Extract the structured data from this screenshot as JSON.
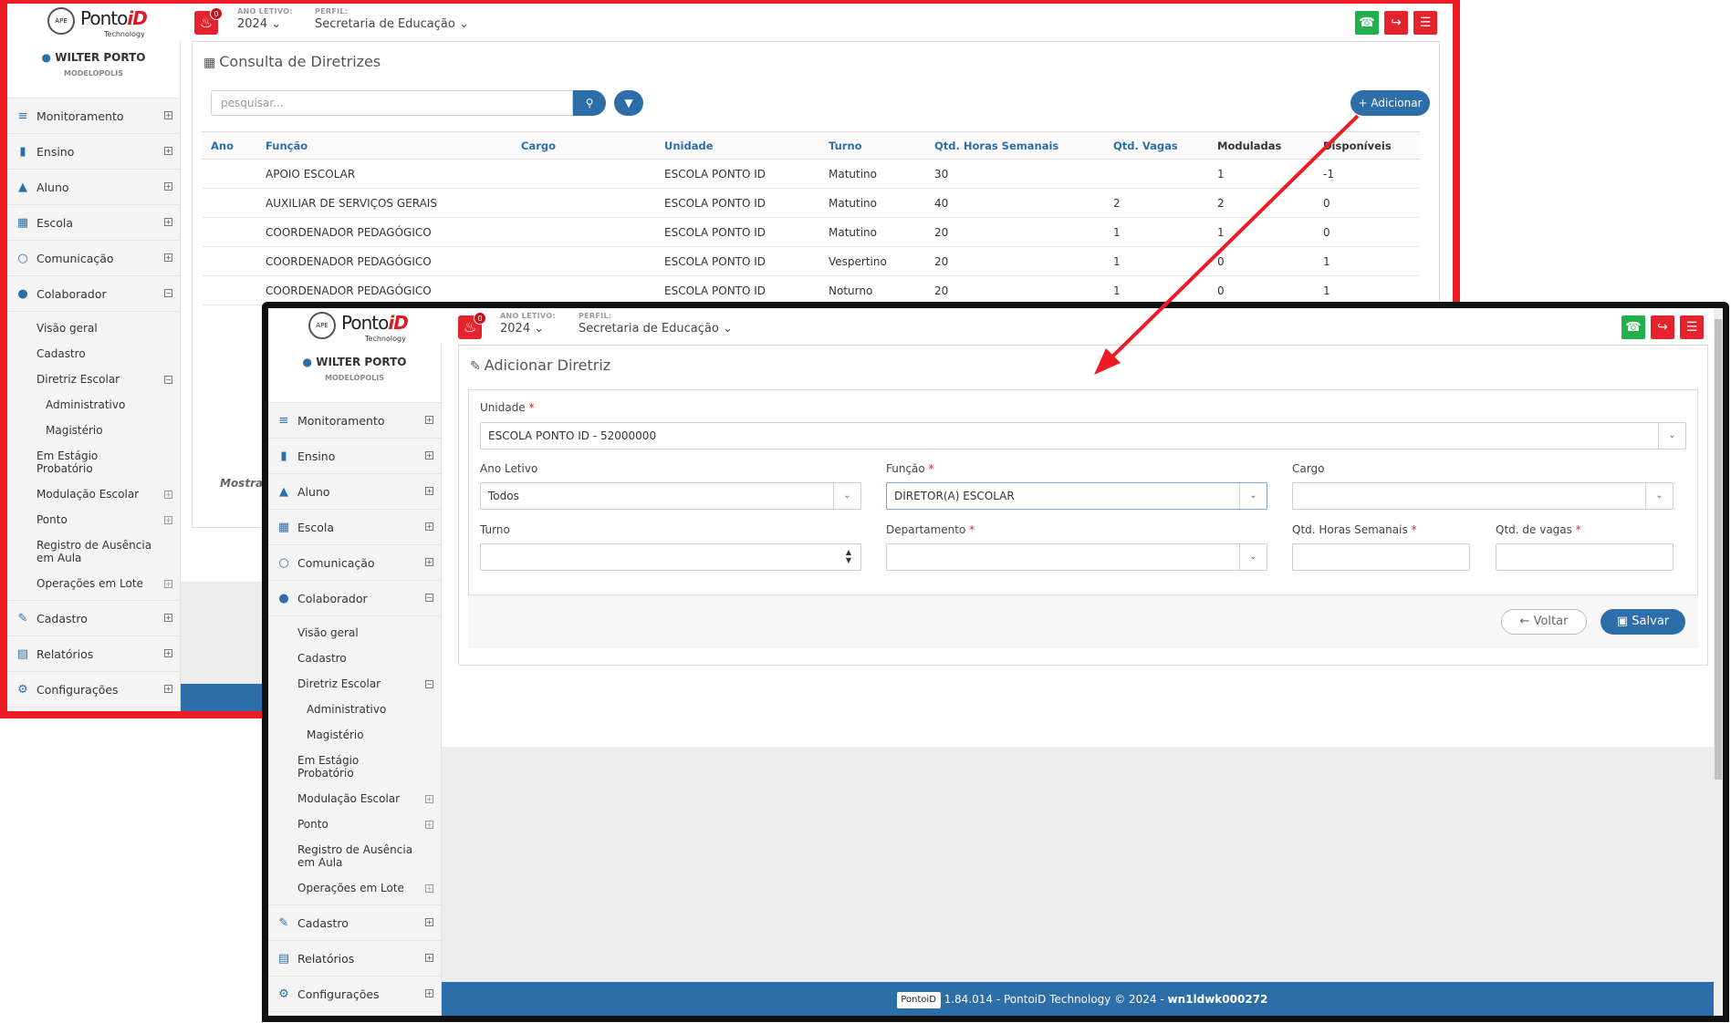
{
  "header": {
    "ano_letivo_label": "ANO LETIVO:",
    "ano_letivo_value": "2024",
    "perfil_label": "PERFIL:",
    "perfil_value": "Secretaria de Educação",
    "notifications": "0",
    "logo_text": "Ponto",
    "logo_accent": "iD",
    "logo_sub": "Technology",
    "logo_badge": "APE"
  },
  "user": {
    "name": "WILTER PORTO",
    "city": "MODELÓPOLIS"
  },
  "menu": {
    "monitoramento": "Monitoramento",
    "ensino": "Ensino",
    "aluno": "Aluno",
    "escola": "Escola",
    "comunicacao": "Comunicação",
    "colaborador": "Colaborador",
    "visao_geral": "Visão geral",
    "cadastro_sub": "Cadastro",
    "diretriz_escolar": "Diretriz Escolar",
    "administrativo": "Administrativo",
    "magisterio": "Magistério",
    "estagio": "Em Estágio Probatório",
    "modulacao": "Modulação Escolar",
    "ponto": "Ponto",
    "registro_ausencia": "Registro de Ausência em Aula",
    "operacoes_lote": "Operações em Lote",
    "cadastro": "Cadastro",
    "relatorios": "Relatórios",
    "configuracoes": "Configurações"
  },
  "consulta": {
    "title": "Consulta de Diretrizes",
    "search_placeholder": "pesquisar...",
    "add_label": "Adicionar",
    "mostrar": "Mostrar",
    "columns": [
      "Ano",
      "Função",
      "Cargo",
      "Unidade",
      "Turno",
      "Qtd. Horas Semanais",
      "Qtd. Vagas",
      "Moduladas",
      "Disponíveis"
    ],
    "rows": [
      [
        "",
        "APOIO ESCOLAR",
        "",
        "ESCOLA PONTO ID",
        "Matutino",
        "30",
        "",
        "1",
        "-1"
      ],
      [
        "",
        "AUXILIAR DE SERVIÇOS GERAIS",
        "",
        "ESCOLA PONTO ID",
        "Matutino",
        "40",
        "2",
        "2",
        "0"
      ],
      [
        "",
        "COORDENADOR PEDAGÓGICO",
        "",
        "ESCOLA PONTO ID",
        "Matutino",
        "20",
        "1",
        "1",
        "0"
      ],
      [
        "",
        "COORDENADOR PEDAGÓGICO",
        "",
        "ESCOLA PONTO ID",
        "Vespertino",
        "20",
        "1",
        "0",
        "1"
      ],
      [
        "",
        "COORDENADOR PEDAGÓGICO",
        "",
        "ESCOLA PONTO ID",
        "Noturno",
        "20",
        "1",
        "0",
        "1"
      ]
    ]
  },
  "form": {
    "title": "Adicionar Diretriz",
    "unidade_label": "Unidade",
    "unidade_value": "ESCOLA PONTO ID - 52000000",
    "ano_label": "Ano Letivo",
    "ano_value": "Todos",
    "funcao_label": "Função",
    "funcao_value": "DIRETOR(A) ESCOLAR",
    "cargo_label": "Cargo",
    "cargo_value": "",
    "turno_label": "Turno",
    "turno_value": "",
    "departamento_label": "Departamento",
    "departamento_value": "",
    "horas_label": "Qtd. Horas Semanais",
    "horas_value": "",
    "vagas_label": "Qtd. de vagas",
    "vagas_value": "",
    "required_mark": "*",
    "voltar_label": "Voltar",
    "salvar_label": "Salvar"
  },
  "footer": {
    "version": "1.84.014 - PontoiD Technology © 2024 - ",
    "host": "wn1ldwk000272",
    "mini_logo": "PontoiD"
  },
  "colors": {
    "accent": "#2d6ea8",
    "alert_red": "#e5232d",
    "whatsapp_green": "#21b04b",
    "highlight_frame": "#ee1b24"
  }
}
